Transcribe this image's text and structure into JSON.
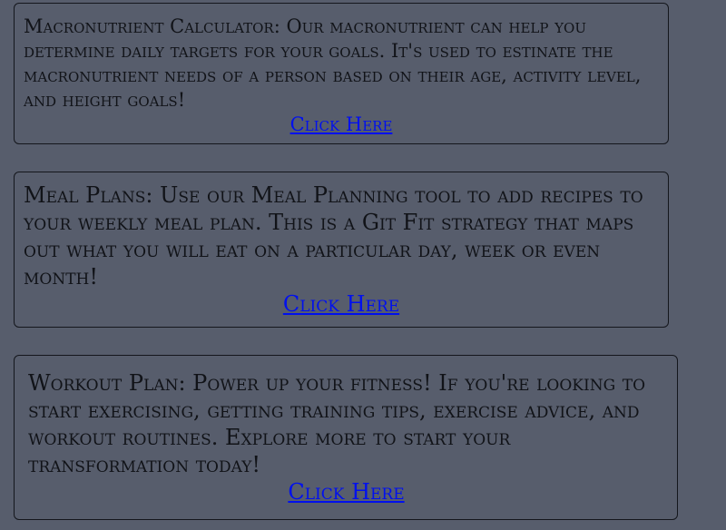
{
  "cards": [
    {
      "text": "Macronutrient Calculator: Our macronutrient can help you determine daily targets for your goals. It's used to estinate the macronutrient needs of a person based on their age, activity level, and height goals!",
      "link_label": "Click Here"
    },
    {
      "text": "Meal Plans: Use our Meal Planning tool to add recipes to your weekly meal plan. This is a Git Fit strategy that maps out what you will eat on a particular day, week or even month!",
      "link_label": "Click Here"
    },
    {
      "text": "Workout Plan: Power up your fitness! If you're looking to start exercising, getting training tips, exercise advice, and workout routines. Explore more to start your transformation today!",
      "link_label": "Click Here"
    }
  ],
  "colors": {
    "background": "#575d6c",
    "text": "#111318",
    "link": "#0010ee",
    "border": "#14161c"
  }
}
